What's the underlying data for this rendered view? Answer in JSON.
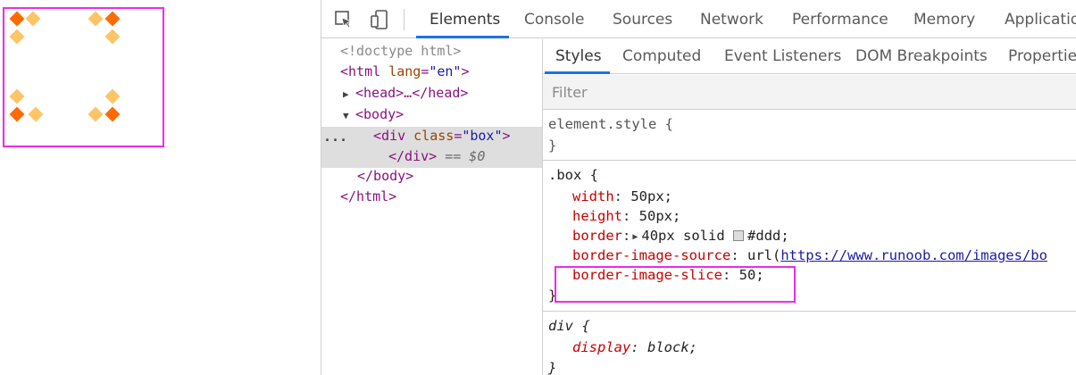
{
  "devtools": {
    "main_tabs": [
      "Elements",
      "Console",
      "Sources",
      "Network",
      "Performance",
      "Memory",
      "Applicatio"
    ],
    "sub_tabs": [
      "Styles",
      "Computed",
      "Event Listeners",
      "DOM Breakpoints",
      "Properties"
    ],
    "filter_placeholder": "Filter",
    "dom": {
      "doctype": "<!doctype html>",
      "html_open_tag": "<html",
      "html_attr_name": "lang",
      "html_attr_value": "\"en\"",
      "head_tag": "<head>…</head>",
      "body_open": "<body>",
      "ellipsis": "...",
      "div_open_tag": "<div",
      "div_attr_name": "class",
      "div_attr_value": "\"box\"",
      "div_close_bracket": ">",
      "div_close": "</div>",
      "selected_marker": "== $0",
      "body_close": "</body>",
      "html_close": "</html>"
    },
    "styles": {
      "element_style_selector": "element.style {",
      "element_style_close": "}",
      "box_selector": ".box {",
      "box_close": "}",
      "box_props": [
        {
          "name": "width",
          "value": "50px;"
        },
        {
          "name": "height",
          "value": "50px;"
        },
        {
          "name": "border",
          "value": "40px solid",
          "color_value": "#ddd;"
        },
        {
          "name": "border-image-source",
          "value_prefix": "url(",
          "link": "https://www.runoob.com/images/bo"
        },
        {
          "name": "border-image-slice",
          "value": "50;"
        }
      ],
      "div_selector": "div {",
      "div_close": "}",
      "div_props": [
        {
          "name": "display",
          "value": "block;"
        }
      ]
    }
  },
  "colors": {
    "highlight": "#ee2be8",
    "diamond_dark": "#ff6b00",
    "diamond_light": "#ffc466",
    "accent": "#1a73e8"
  }
}
